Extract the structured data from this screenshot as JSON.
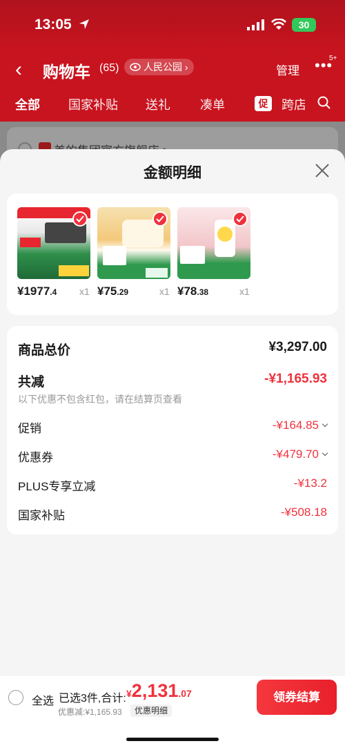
{
  "status_bar": {
    "time": "13:05",
    "battery": "30"
  },
  "header": {
    "back_icon": "chevron-left-icon",
    "title": "购物车",
    "count": "(65)",
    "location": "人民公园",
    "manage": "管理",
    "more_badge": "5+"
  },
  "tabs": [
    {
      "label": "全部",
      "active": true
    },
    {
      "label": "国家补贴"
    },
    {
      "label": "送礼"
    },
    {
      "label": "凑单"
    },
    {
      "label": "跨店"
    }
  ],
  "tabs_promo_tag": "促",
  "store": {
    "name": "美的集团官方旗舰店 >"
  },
  "sheet": {
    "title": "金额明细",
    "products": [
      {
        "price_int": "¥1977",
        "price_dec": ".4",
        "qty": "x1",
        "thumb_color": "#2f8f4a"
      },
      {
        "price_int": "¥75",
        "price_dec": ".29",
        "qty": "x1",
        "thumb_color": "#f3c97b"
      },
      {
        "price_int": "¥78",
        "price_dec": ".38",
        "qty": "x1",
        "thumb_color": "#f2c6c9"
      }
    ],
    "totals": {
      "goods_total_label": "商品总价",
      "goods_total_value": "¥3,297.00",
      "reduction_label": "共减",
      "reduction_value": "-¥1,165.93",
      "reduction_note": "以下优惠不包含红包，请在结算页查看",
      "rows": [
        {
          "label": "促销",
          "value": "-¥164.85",
          "expand": true
        },
        {
          "label": "优惠券",
          "value": "-¥479.70",
          "expand": true
        },
        {
          "label": "PLUS专享立减",
          "value": "-¥13.2",
          "expand": false
        },
        {
          "label": "国家补贴",
          "value": "-¥508.18",
          "expand": false
        }
      ]
    }
  },
  "bottom_bar": {
    "select_all": "全选",
    "summary": "已选3件,合计:",
    "total_currency": "¥",
    "total_int": "2,131",
    "total_dec": ".07",
    "discount": "优惠减:¥1,165.93",
    "detail_button": "优惠明细",
    "checkout": "领券结算"
  },
  "colors": {
    "brand_red": "#c8141f",
    "price_red": "#f0313c"
  }
}
